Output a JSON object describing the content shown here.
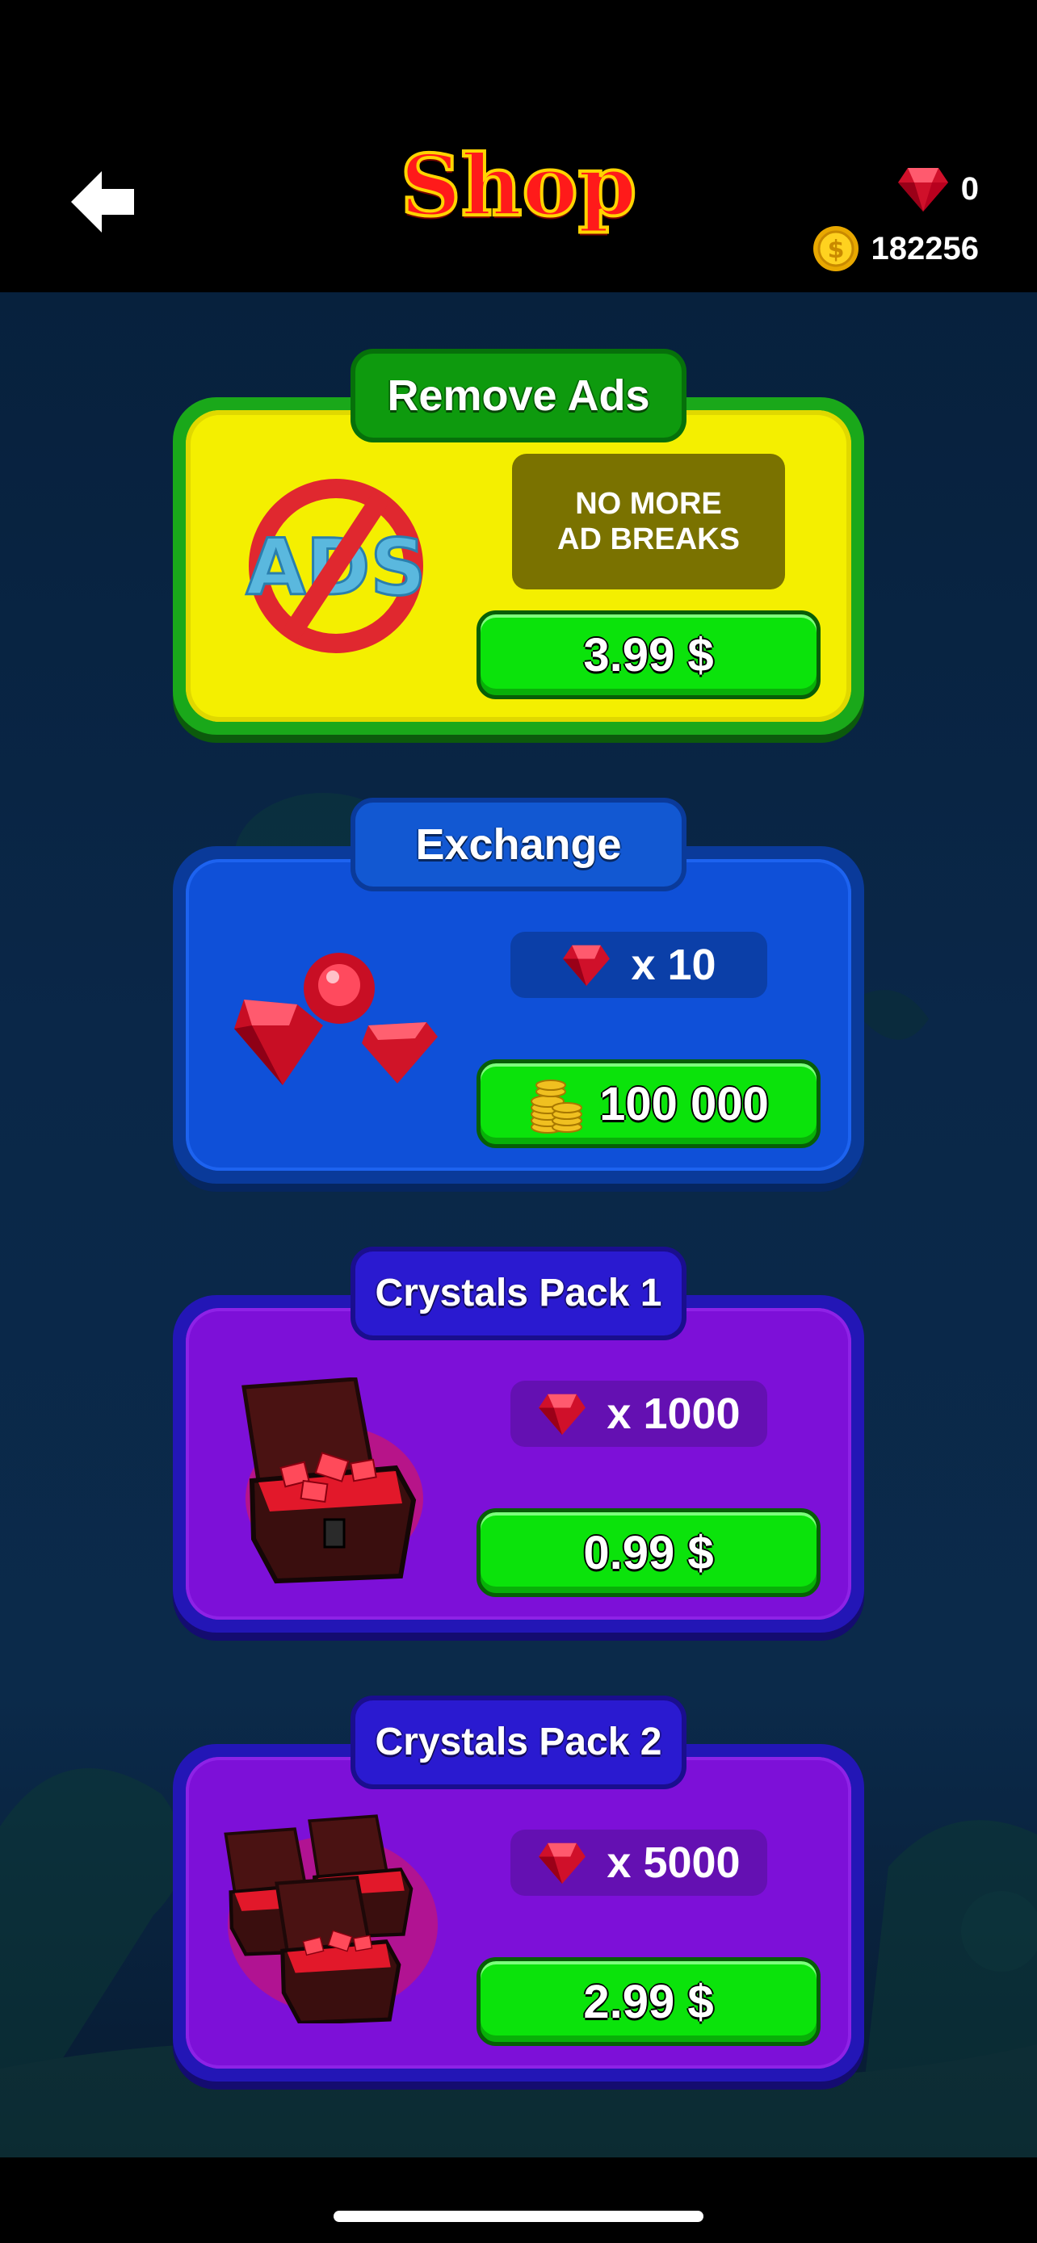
{
  "header": {
    "title": "Shop",
    "gems": "0",
    "coins": "182256"
  },
  "offers": {
    "remove_ads": {
      "tab": "Remove Ads",
      "desc_line1": "NO MORE",
      "desc_line2": "AD BREAKS",
      "price": "3.99 $",
      "icon_text": "ADS"
    },
    "exchange": {
      "tab": "Exchange",
      "amount": "x 10",
      "price": "100 000"
    },
    "crystals_pack_1": {
      "tab": "Crystals Pack 1",
      "amount": "x 1000",
      "price": "0.99 $"
    },
    "crystals_pack_2": {
      "tab": "Crystals Pack 2",
      "amount": "x 5000",
      "price": "2.99 $"
    }
  },
  "colors": {
    "remove_ads_card": "#f4ef00",
    "exchange_card": "#0f50d8",
    "crystals_card": "#7d10d8",
    "buy_button": "#0be30b"
  },
  "icons": [
    "back-arrow-icon",
    "ruby-icon",
    "coin-icon",
    "no-ads-icon",
    "rubies-icon",
    "coin-stack-icon",
    "treasure-chest-icon",
    "treasure-chests-icon"
  ]
}
